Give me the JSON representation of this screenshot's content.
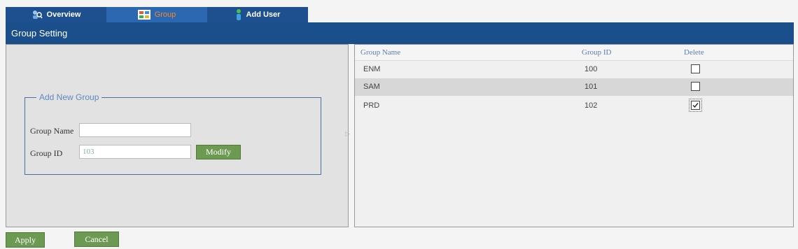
{
  "tabs": [
    {
      "label": "Overview",
      "icon": "user-magnifier-icon"
    },
    {
      "label": "Group",
      "icon": "group-grid-icon",
      "active": true
    },
    {
      "label": "Add User",
      "icon": "add-user-icon"
    }
  ],
  "header": {
    "title": "Group Setting"
  },
  "form": {
    "legend": "Add New Group",
    "group_name_label": "Group Name",
    "group_name_value": "",
    "group_id_label": "Group ID",
    "group_id_value": "103",
    "modify_label": "Modify"
  },
  "table": {
    "headers": [
      "Group Name",
      "Group ID",
      "Delete"
    ],
    "rows": [
      {
        "name": "ENM",
        "id": "100",
        "delete": false
      },
      {
        "name": "SAM",
        "id": "101",
        "delete": false
      },
      {
        "name": "PRD",
        "id": "102",
        "delete": true
      }
    ]
  },
  "footer": {
    "apply_label": "Apply",
    "cancel_label": "Cancel"
  },
  "colors": {
    "header_blue": "#1a4f8c",
    "tab_active": "#2c67b2",
    "button_green": "#6c9a52",
    "active_tab_text": "#f08a2a"
  }
}
